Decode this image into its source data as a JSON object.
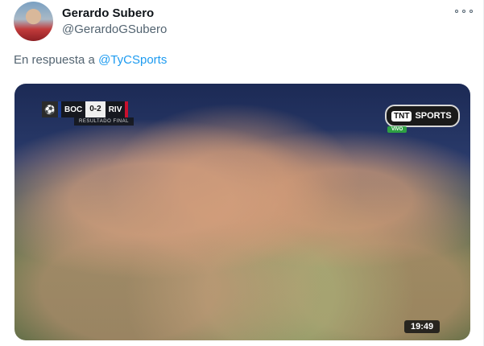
{
  "author": {
    "display_name": "Gerardo Subero",
    "handle": "@GerardoGSubero"
  },
  "reply": {
    "prefix": "En respuesta a ",
    "mention": "@TyCSports"
  },
  "media": {
    "scorebug": {
      "home": "BOC",
      "score": "0-2",
      "away": "RIV",
      "status": "RESULTADO FINAL"
    },
    "channel": {
      "logo_mark": "TNT",
      "name": "SPORTS",
      "live_label": "VIVO"
    },
    "timecode": "19:49"
  },
  "colors": {
    "link": "#1d9bf0",
    "home_team": "#1b3a8c",
    "away_team": "#c8102e"
  }
}
